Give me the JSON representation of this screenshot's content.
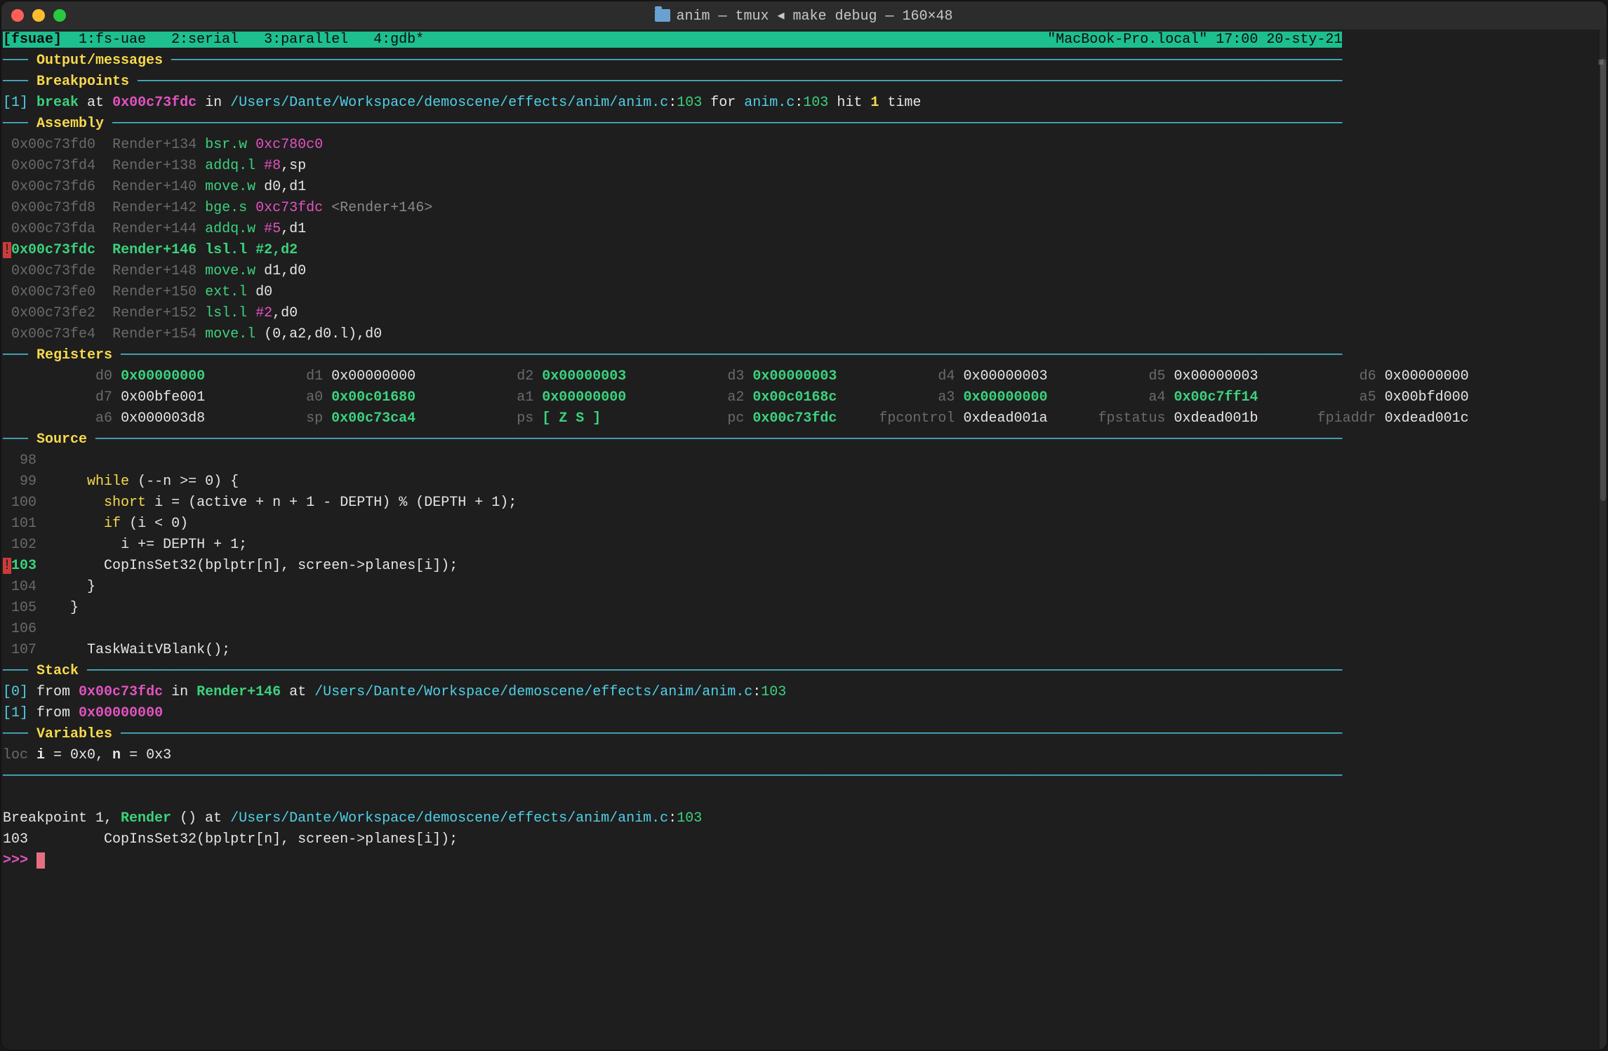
{
  "title": "anim — tmux ◂ make debug — 160×48",
  "statusbar": {
    "left_session": "[fsuae]",
    "tabs": "  1:fs-uae   2:serial   3:parallel   4:gdb*",
    "right": "\"MacBook-Pro.local\" 17:00 20-sty-21"
  },
  "sections": {
    "output": "Output/messages",
    "breakpoints": "Breakpoints",
    "assembly": "Assembly",
    "registers": "Registers",
    "source": "Source",
    "stack": "Stack",
    "variables": "Variables"
  },
  "breakpoints_line": {
    "idx": "[1]",
    "kw_break": "break",
    "at": " at ",
    "addr": "0x00c73fdc",
    "in": " in ",
    "path": "/Users/Dante/Workspace/demoscene/effects/anim/anim.c",
    "loc_colon": ":",
    "loc_line": "103",
    "for": " for ",
    "for_file": "anim.c",
    "for_line": "103",
    "hit": " hit ",
    "hit_n": "1",
    "time": " time"
  },
  "asm": [
    {
      "addr": "0x00c73fd0",
      "sym": "Render+134",
      "mn": "bsr.w",
      "ops": "0xc780c0",
      "hl": false
    },
    {
      "addr": "0x00c73fd4",
      "sym": "Render+138",
      "mn": "addq.l",
      "ops": "#8,sp",
      "hl": false
    },
    {
      "addr": "0x00c73fd6",
      "sym": "Render+140",
      "mn": "move.w",
      "ops": "d0,d1",
      "hl": false
    },
    {
      "addr": "0x00c73fd8",
      "sym": "Render+142",
      "mn": "bge.s",
      "ops": "0xc73fdc <Render+146>",
      "hl": false,
      "opsplit": [
        "0xc73fdc",
        " <",
        "Render+146",
        ">"
      ]
    },
    {
      "addr": "0x00c73fda",
      "sym": "Render+144",
      "mn": "addq.w",
      "ops": "#5,d1",
      "hl": false
    },
    {
      "addr": "0x00c73fdc",
      "sym": "Render+146",
      "mn": "lsl.l",
      "ops": "#2,d2",
      "hl": true
    },
    {
      "addr": "0x00c73fde",
      "sym": "Render+148",
      "mn": "move.w",
      "ops": "d1,d0",
      "hl": false
    },
    {
      "addr": "0x00c73fe0",
      "sym": "Render+150",
      "mn": "ext.l",
      "ops": "d0",
      "hl": false
    },
    {
      "addr": "0x00c73fe2",
      "sym": "Render+152",
      "mn": "lsl.l",
      "ops": "#2,d0",
      "hl": false
    },
    {
      "addr": "0x00c73fe4",
      "sym": "Render+154",
      "mn": "move.l",
      "ops": "(0,a2,d0.l),d0",
      "hl": false
    }
  ],
  "registers": {
    "row1": [
      {
        "n": "d0",
        "v": "0x00000000",
        "b": true
      },
      {
        "n": "d1",
        "v": "0x00000000",
        "b": false
      },
      {
        "n": "d2",
        "v": "0x00000003",
        "b": true
      },
      {
        "n": "d3",
        "v": "0x00000003",
        "b": true
      },
      {
        "n": "d4",
        "v": "0x00000003",
        "b": false
      },
      {
        "n": "d5",
        "v": "0x00000003",
        "b": false
      },
      {
        "n": "d6",
        "v": "0x00000000",
        "b": false
      }
    ],
    "row2": [
      {
        "n": "d7",
        "v": "0x00bfe001",
        "b": false
      },
      {
        "n": "a0",
        "v": "0x00c01680",
        "b": true
      },
      {
        "n": "a1",
        "v": "0x00000000",
        "b": true
      },
      {
        "n": "a2",
        "v": "0x00c0168c",
        "b": true
      },
      {
        "n": "a3",
        "v": "0x00000000",
        "b": true
      },
      {
        "n": "a4",
        "v": "0x00c7ff14",
        "b": true
      },
      {
        "n": "a5",
        "v": "0x00bfd000",
        "b": false
      }
    ],
    "row3": [
      {
        "n": "a6",
        "v": "0x000003d8",
        "b": false
      },
      {
        "n": "sp",
        "v": "0x00c73ca4",
        "b": true
      },
      {
        "n": "ps",
        "v": "[ Z S ]",
        "b": true
      },
      {
        "n": "pc",
        "v": "0x00c73fdc",
        "b": true
      },
      {
        "n": "fpcontrol",
        "v": "0xdead001a",
        "b": false
      },
      {
        "n": "fpstatus",
        "v": "0xdead001b",
        "b": false
      },
      {
        "n": "fpiaddr",
        "v": "0xdead001c",
        "b": false
      }
    ]
  },
  "source": [
    {
      "n": "98",
      "t": "",
      "hl": false
    },
    {
      "n": "99",
      "pre": "    ",
      "tok": [
        "while",
        " (",
        "--",
        "n",
        " ",
        ">=",
        " ",
        "0",
        ") {"
      ],
      "hl": false
    },
    {
      "n": "100",
      "pre": "      ",
      "tok": [
        "short",
        " i",
        " = (",
        "active",
        " + ",
        "n",
        " + ",
        "1",
        " - ",
        "DEPTH",
        ") % (",
        "DEPTH",
        " + ",
        "1",
        ");"
      ],
      "hl": false
    },
    {
      "n": "101",
      "pre": "      ",
      "tok": [
        "if",
        " (",
        "i",
        " < ",
        "0",
        ")"
      ],
      "hl": false
    },
    {
      "n": "102",
      "pre": "        ",
      "tok": [
        "i",
        " += ",
        "DEPTH",
        " + ",
        "1",
        ";"
      ],
      "hl": false
    },
    {
      "n": "103",
      "pre": "      ",
      "tok": [
        "CopInsSet32",
        "(",
        "bplptr",
        "[",
        "n",
        "], ",
        "screen",
        "->",
        "planes",
        "[",
        "i",
        "]);"
      ],
      "hl": true
    },
    {
      "n": "104",
      "pre": "    ",
      "tok": [
        "}"
      ],
      "hl": false
    },
    {
      "n": "105",
      "pre": "  ",
      "tok": [
        "}"
      ],
      "hl": false
    },
    {
      "n": "106",
      "t": "",
      "hl": false
    },
    {
      "n": "107",
      "pre": "    ",
      "tok": [
        "TaskWaitVBlank",
        "();"
      ],
      "hl": false
    }
  ],
  "stack": [
    {
      "idx": "[0]",
      "addr": "0x00c73fdc",
      "sym": "Render+146",
      "path": "/Users/Dante/Workspace/demoscene/effects/anim/anim.c",
      "line": "103"
    },
    {
      "idx": "[1]",
      "addr": "0x00000000"
    }
  ],
  "variables": "loc i = 0x0, n = 0x3",
  "bottom": {
    "bp_line_a": "Breakpoint 1, ",
    "bp_func": "Render",
    "bp_line_b": " () at ",
    "bp_path": "/Users/Dante/Workspace/demoscene/effects/anim/anim.c",
    "bp_colon": ":",
    "bp_line": "103",
    "src_line_no": "103",
    "src_line": "         CopInsSet32(bplptr[n], screen->planes[i]);",
    "prompt": ">>> "
  }
}
